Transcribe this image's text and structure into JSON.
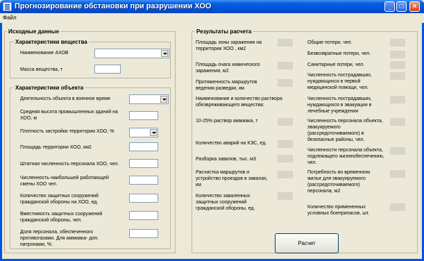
{
  "window": {
    "title": "Прогнозирование обстановки при разрушении ХОО",
    "minimize": "_",
    "maximize": "□",
    "close": "×"
  },
  "menu": {
    "file": "Файл"
  },
  "input": {
    "group_title": "Исходные данные",
    "substance": {
      "title": "Характеристики вещества",
      "name_label": "Наименование АХОВ",
      "mass_label": "Масса вещества, т"
    },
    "object": {
      "title": "Характеристики объекта",
      "activity_label": "Деятельность объекта в военное время",
      "height_label": "Средняя высота промышленных зданий на ХОО, м",
      "density_label": "Плотность застройки территории ХОО, %",
      "area_label": "Площадь территории ХОО, км2",
      "staff_label": "Штатная численность персонала ХОО, чел.",
      "shift_label": "Численность наибольшей работающей смены ХОО чел.",
      "shelters_label": "Количество защитных сооружений гражданской обороны на ХОО, ед.",
      "capacity_label": "Вместимость защитных сооружений гражданской обороны, чел.",
      "gasmask_label": "Доля персонала, обеспеченного противогазами. Для аммиака- доп. патронами, %."
    }
  },
  "results": {
    "title": "Результаты расчета",
    "left": [
      "Площадь зоны заражения на территории ХОО , км2",
      "Площадь очага химического заражения, м2",
      "Протяженность маршрутов ведения разведки, км",
      "Наименование и количество раствора обезвреживающего вещества:",
      "10-25% раствор аммиака, т",
      "Количество аварий на КЭС, ед.",
      "Разборка завалов, тыс. м3",
      "Расчистка маршрутов и устройство проездов в завалах, км",
      "Количество заваленных защитных сооружений гражданской обороны, ед."
    ],
    "right": [
      "Общие потери, чел.",
      "Безвозвратные потери, чел.",
      "Санитарные потери, чел.",
      "Численность пострадавших, нуждающихся в первой медицинской помощи, чел.",
      "Численность пострадавших, нуждающихся в эвакуации в лечебные учреждения",
      "Численность персонала объекта, эвакуируемого (рассредоточиваемого) в безопасные районы, чел.",
      "Численности персонала объекта, подлежащего жизнеобеспечению, чел.",
      "Потребность во временном жилье для эвакуируемого (рассредоточиваемого) персонала,  м2",
      "Количество примененных условных боеприпасов, шт."
    ]
  },
  "buttons": {
    "calculate": "Расчет"
  }
}
